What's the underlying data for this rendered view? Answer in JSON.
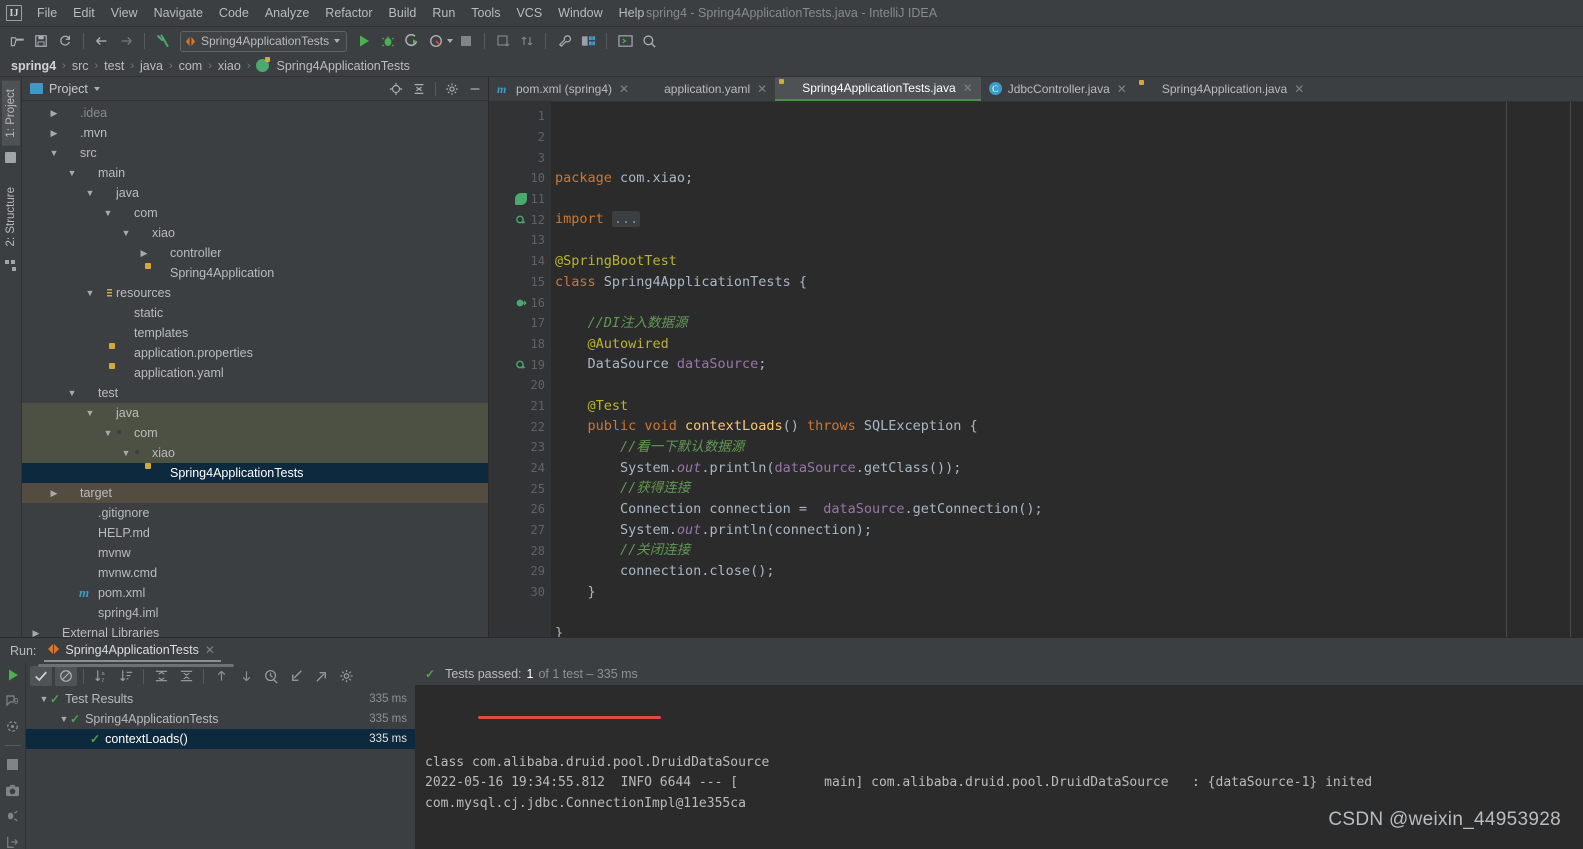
{
  "window": {
    "title": "spring4 - Spring4ApplicationTests.java - IntelliJ IDEA",
    "logo": "IJ"
  },
  "menu": {
    "items": [
      "File",
      "Edit",
      "View",
      "Navigate",
      "Code",
      "Analyze",
      "Refactor",
      "Build",
      "Run",
      "Tools",
      "VCS",
      "Window",
      "Help"
    ]
  },
  "toolbar": {
    "icons": [
      "open-folder-icon",
      "save-icon",
      "sync-icon",
      "back-arrow-icon",
      "forward-arrow-icon",
      "build-hammer-icon"
    ],
    "run_config": "Spring4ApplicationTests",
    "right_icons": [
      "run-icon",
      "debug-icon",
      "run-with-coverage-icon",
      "profiler-icon",
      "stop-icon",
      "update-project-icon",
      "commit-icon",
      "settings-wrench-icon",
      "project-structure-icon",
      "terminal-icon",
      "search-everywhere-icon"
    ]
  },
  "breadcrumb": {
    "items": [
      "spring4",
      "src",
      "test",
      "java",
      "com",
      "xiao",
      "Spring4ApplicationTests"
    ],
    "separator": "›"
  },
  "left_strip": {
    "tabs": [
      {
        "label": "1: Project",
        "icon": "project-folder-icon",
        "active": true
      },
      {
        "label": "2: Structure",
        "icon": "structure-icon",
        "active": false
      }
    ]
  },
  "project_panel": {
    "title": "Project",
    "actions": [
      "locate-target-icon",
      "collapse-all-icon",
      "settings-gear-icon",
      "hide-minus-icon"
    ],
    "tree": [
      {
        "label": ".idea",
        "indent": 1,
        "arrow": "▶",
        "icon": "folder-icon",
        "state": "normal",
        "cut": true
      },
      {
        "label": ".mvn",
        "indent": 1,
        "arrow": "▶",
        "icon": "folder-icon",
        "state": "normal"
      },
      {
        "label": "src",
        "indent": 1,
        "arrow": "▼",
        "icon": "folder-icon",
        "state": "normal"
      },
      {
        "label": "main",
        "indent": 2,
        "arrow": "▼",
        "icon": "folder-icon",
        "state": "normal"
      },
      {
        "label": "java",
        "indent": 3,
        "arrow": "▼",
        "icon": "folder-blue-icon",
        "state": "normal"
      },
      {
        "label": "com",
        "indent": 4,
        "arrow": "▼",
        "icon": "package-icon",
        "state": "normal"
      },
      {
        "label": "xiao",
        "indent": 5,
        "arrow": "▼",
        "icon": "package-icon",
        "state": "normal"
      },
      {
        "label": "controller",
        "indent": 6,
        "arrow": "▶",
        "icon": "package-icon",
        "state": "normal"
      },
      {
        "label": "Spring4Application",
        "indent": 6,
        "arrow": "",
        "icon": "spring-boot-icon",
        "state": "normal"
      },
      {
        "label": "resources",
        "indent": 3,
        "arrow": "▼",
        "icon": "resources-folder-icon",
        "state": "normal"
      },
      {
        "label": "static",
        "indent": 4,
        "arrow": "",
        "icon": "folder-icon",
        "state": "normal"
      },
      {
        "label": "templates",
        "indent": 4,
        "arrow": "",
        "icon": "folder-icon",
        "state": "normal"
      },
      {
        "label": "application.properties",
        "indent": 4,
        "arrow": "",
        "icon": "spring-config-icon",
        "state": "normal"
      },
      {
        "label": "application.yaml",
        "indent": 4,
        "arrow": "",
        "icon": "spring-config-icon",
        "state": "normal"
      },
      {
        "label": "test",
        "indent": 2,
        "arrow": "▼",
        "icon": "folder-icon",
        "state": "normal"
      },
      {
        "label": "java",
        "indent": 3,
        "arrow": "▼",
        "icon": "folder-green-icon",
        "state": "test-source"
      },
      {
        "label": "com",
        "indent": 4,
        "arrow": "▼",
        "icon": "package-icon",
        "state": "test-source"
      },
      {
        "label": "xiao",
        "indent": 5,
        "arrow": "▼",
        "icon": "package-icon",
        "state": "test-source"
      },
      {
        "label": "Spring4ApplicationTests",
        "indent": 6,
        "arrow": "",
        "icon": "spring-boot-icon",
        "state": "selected"
      },
      {
        "label": "target",
        "indent": 1,
        "arrow": "▶",
        "icon": "folder-orange-icon",
        "state": "excluded"
      },
      {
        "label": ".gitignore",
        "indent": 2,
        "arrow": "",
        "icon": "gitignore-file-icon",
        "state": "normal"
      },
      {
        "label": "HELP.md",
        "indent": 2,
        "arrow": "",
        "icon": "markdown-file-icon",
        "state": "normal"
      },
      {
        "label": "mvnw",
        "indent": 2,
        "arrow": "",
        "icon": "shell-script-icon",
        "state": "normal"
      },
      {
        "label": "mvnw.cmd",
        "indent": 2,
        "arrow": "",
        "icon": "cmd-file-icon",
        "state": "normal"
      },
      {
        "label": "pom.xml",
        "indent": 2,
        "arrow": "",
        "icon": "maven-file-icon",
        "state": "normal"
      },
      {
        "label": "spring4.iml",
        "indent": 2,
        "arrow": "",
        "icon": "module-file-icon",
        "state": "normal"
      },
      {
        "label": "External Libraries",
        "indent": 0,
        "arrow": "▶",
        "icon": "libraries-icon",
        "state": "normal"
      }
    ]
  },
  "editor": {
    "tabs": [
      {
        "label": "pom.xml (spring4)",
        "icon": "maven-file-icon",
        "active": false
      },
      {
        "label": "application.yaml",
        "icon": "spring-config-icon",
        "active": false
      },
      {
        "label": "Spring4ApplicationTests.java",
        "icon": "spring-boot-icon",
        "active": true
      },
      {
        "label": "JdbcController.java",
        "icon": "java-class-icon",
        "active": false
      },
      {
        "label": "Spring4Application.java",
        "icon": "spring-boot-icon",
        "active": false
      }
    ],
    "line_numbers": [
      1,
      2,
      3,
      10,
      11,
      12,
      13,
      14,
      15,
      16,
      17,
      18,
      19,
      20,
      21,
      22,
      23,
      24,
      25,
      26,
      27,
      28,
      29,
      30
    ],
    "gutter_marks": {
      "11": "spring-leaf-icon",
      "12": "run-test-class-icon",
      "16": "bean-injection-icon",
      "19": "run-test-method-icon"
    },
    "code": [
      {
        "n": 1,
        "segments": [
          {
            "t": "package ",
            "c": "k"
          },
          {
            "t": "com.xiao;",
            "c": "pl"
          }
        ]
      },
      {
        "n": 2,
        "segments": []
      },
      {
        "n": 3,
        "segments": [
          {
            "t": "import ",
            "c": "k"
          },
          {
            "t": "...",
            "c": "fold"
          }
        ],
        "fold": true
      },
      {
        "n": 10,
        "segments": []
      },
      {
        "n": 11,
        "segments": [
          {
            "t": "@SpringBootTest",
            "c": "an"
          }
        ]
      },
      {
        "n": 12,
        "segments": [
          {
            "t": "class ",
            "c": "k"
          },
          {
            "t": "Spring4ApplicationTests ",
            "c": "pl"
          },
          {
            "t": "{",
            "c": "pl"
          }
        ]
      },
      {
        "n": 13,
        "segments": []
      },
      {
        "n": 14,
        "segments": [
          {
            "t": "    //DI注入数据源",
            "c": "cm"
          }
        ]
      },
      {
        "n": 15,
        "segments": [
          {
            "t": "    @Autowired",
            "c": "an"
          }
        ]
      },
      {
        "n": 16,
        "segments": [
          {
            "t": "    DataSource ",
            "c": "pl"
          },
          {
            "t": "dataSource",
            "c": "fl"
          },
          {
            "t": ";",
            "c": "pl"
          }
        ]
      },
      {
        "n": 17,
        "segments": []
      },
      {
        "n": 18,
        "segments": [
          {
            "t": "    @Test",
            "c": "an"
          }
        ]
      },
      {
        "n": 19,
        "segments": [
          {
            "t": "    public void ",
            "c": "k"
          },
          {
            "t": "contextLoads",
            "c": "fn"
          },
          {
            "t": "() ",
            "c": "pl"
          },
          {
            "t": "throws ",
            "c": "k"
          },
          {
            "t": "SQLException {",
            "c": "pl"
          }
        ]
      },
      {
        "n": 20,
        "segments": [
          {
            "t": "        //看一下默认数据源",
            "c": "cm"
          }
        ]
      },
      {
        "n": 21,
        "segments": [
          {
            "t": "        System.",
            "c": "pl"
          },
          {
            "t": "out",
            "c": "fli"
          },
          {
            "t": ".println(",
            "c": "pl"
          },
          {
            "t": "dataSource",
            "c": "fl"
          },
          {
            "t": ".getClass());",
            "c": "pl"
          }
        ]
      },
      {
        "n": 22,
        "segments": [
          {
            "t": "        //获得连接",
            "c": "cm"
          }
        ]
      },
      {
        "n": 23,
        "segments": [
          {
            "t": "        Connection connection =  ",
            "c": "pl"
          },
          {
            "t": "dataSource",
            "c": "fl"
          },
          {
            "t": ".getConnection();",
            "c": "pl"
          }
        ]
      },
      {
        "n": 24,
        "segments": [
          {
            "t": "        System.",
            "c": "pl"
          },
          {
            "t": "out",
            "c": "fli"
          },
          {
            "t": ".println(connection);",
            "c": "pl"
          }
        ]
      },
      {
        "n": 25,
        "segments": [
          {
            "t": "        //关闭连接",
            "c": "cm"
          }
        ]
      },
      {
        "n": 26,
        "segments": [
          {
            "t": "        connection.close();",
            "c": "pl"
          }
        ]
      },
      {
        "n": 27,
        "segments": [
          {
            "t": "    }",
            "c": "pl"
          }
        ]
      },
      {
        "n": 28,
        "segments": []
      },
      {
        "n": 29,
        "segments": [
          {
            "t": "}",
            "c": "pl"
          }
        ]
      },
      {
        "n": 30,
        "segments": []
      }
    ]
  },
  "run_panel": {
    "label": "Run:",
    "tab": "Spring4ApplicationTests",
    "left_icons": [
      "rerun-icon",
      "rerun-failed-icon",
      "toggle-auto-test-icon",
      "stop-icon",
      "screenshot-icon",
      "dump-threads-icon",
      "export-icon"
    ],
    "toolbar_icons": [
      "show-passed-icon",
      "show-ignored-icon",
      "sort-alphabetically-icon",
      "sort-by-duration-icon",
      "expand-all-icon",
      "collapse-all-icon",
      "prev-failed-icon",
      "next-failed-icon",
      "history-icon",
      "import-tests-icon",
      "export-tests-icon",
      "settings-gear-icon"
    ],
    "tests": [
      {
        "label": "Test Results",
        "duration": "335 ms",
        "indent": 0,
        "arrow": "▼",
        "status": "passed",
        "selected": false
      },
      {
        "label": "Spring4ApplicationTests",
        "duration": "335 ms",
        "indent": 1,
        "arrow": "▼",
        "status": "passed",
        "selected": false
      },
      {
        "label": "contextLoads()",
        "duration": "335 ms",
        "indent": 2,
        "arrow": "",
        "status": "passed",
        "selected": true
      }
    ],
    "status": {
      "prefix": "Tests passed:",
      "count": "1",
      "suffix": "of 1 test – 335 ms"
    },
    "console": [
      "class com.alibaba.druid.pool.DruidDataSource",
      "2022-05-16 19:34:55.812  INFO 6644 --- [           main] com.alibaba.druid.pool.DruidDataSource   : {dataSource-1} inited",
      "com.mysql.cj.jdbc.ConnectionImpl@11e355ca"
    ]
  },
  "watermark": "CSDN @weixin_44953928",
  "colors": {
    "bg_panel": "#3c3f41",
    "bg_editor": "#2b2b2b",
    "selection": "#0d293e",
    "test_source": "#4c5144",
    "excluded": "#554c41",
    "accent_green": "#4aa96c",
    "accent_blue": "#3d9cc9",
    "keyword": "#cc7832",
    "annotation": "#bbb529",
    "comment": "#629755",
    "field": "#9876aa",
    "method": "#ffc66d",
    "red_underline": "#e04a3f"
  }
}
